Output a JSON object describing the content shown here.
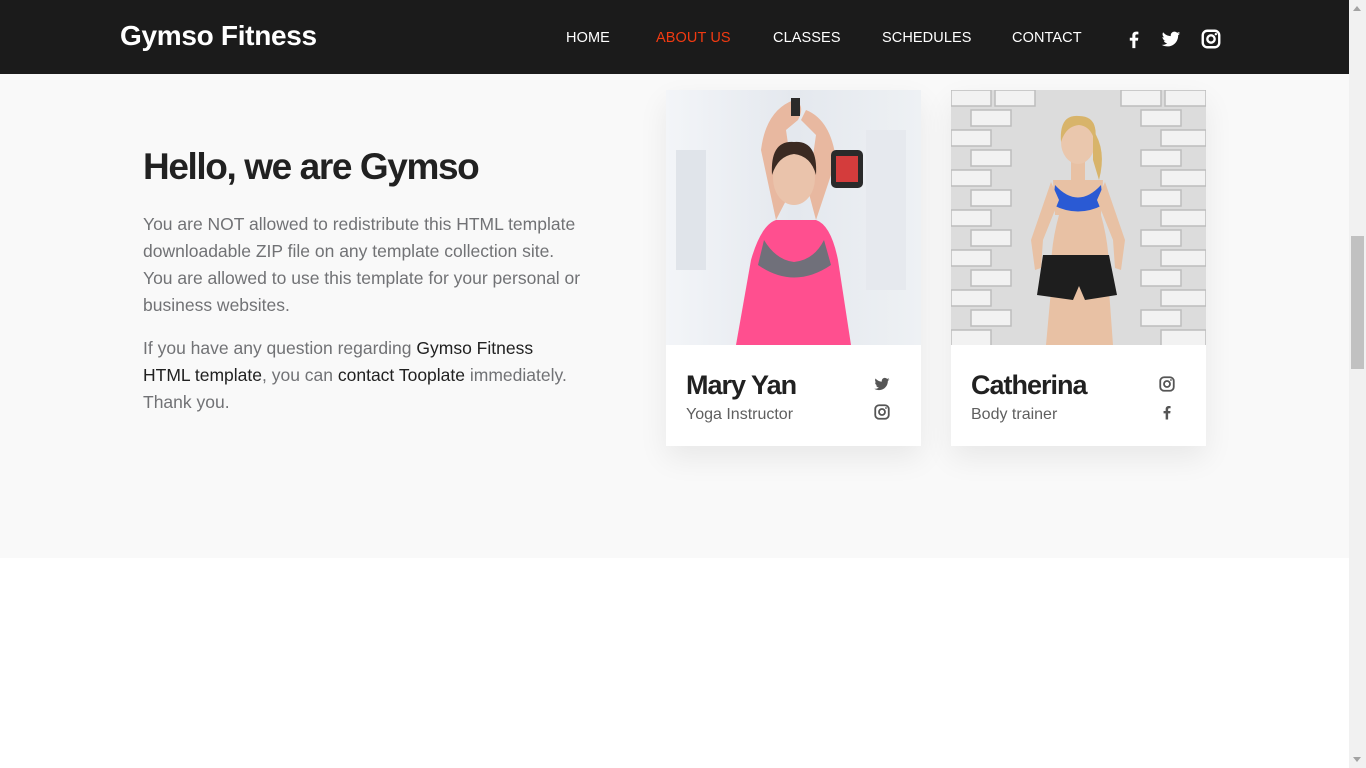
{
  "brand": "Gymso Fitness",
  "nav": {
    "items": [
      {
        "label": "HOME",
        "active": false
      },
      {
        "label": "ABOUT US",
        "active": true
      },
      {
        "label": "CLASSES",
        "active": false
      },
      {
        "label": "SCHEDULES",
        "active": false
      },
      {
        "label": "CONTACT",
        "active": false
      }
    ],
    "social": [
      "facebook-icon",
      "twitter-icon",
      "instagram-icon"
    ],
    "active_color": "#f13a11"
  },
  "about": {
    "heading": "Hello, we are Gymso",
    "para1": "You are NOT allowed to redistribute this HTML template downloadable ZIP file on any template collection site. You are allowed to use this template for your personal or business websites.",
    "para2_before": "If you have any question regarding ",
    "para2_link1": "Gymso Fitness HTML template",
    "para2_middle": ", you can ",
    "para2_link2": "contact Tooplate",
    "para2_after": " immediately. Thank you."
  },
  "trainers": [
    {
      "name": "Mary Yan",
      "role": "Yoga Instructor",
      "icons": [
        "twitter-icon",
        "instagram-icon"
      ]
    },
    {
      "name": "Catherina",
      "role": "Body trainer",
      "icons": [
        "instagram-icon",
        "facebook-icon"
      ]
    }
  ]
}
